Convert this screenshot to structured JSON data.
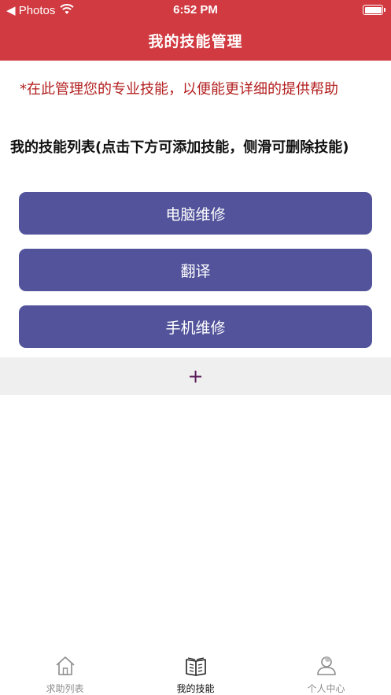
{
  "status_bar": {
    "back_label": "◀ Photos",
    "time": "6:52 PM"
  },
  "nav": {
    "title": "我的技能管理"
  },
  "notice": "*在此管理您的专业技能，以便能更详细的提供帮助",
  "section_title": "我的技能列表(点击下方可添加技能，侧滑可删除技能)",
  "skills": [
    "电脑维修",
    "翻译",
    "手机维修"
  ],
  "add_label": "+",
  "tabs": [
    {
      "label": "求助列表",
      "icon": "home-icon",
      "active": false
    },
    {
      "label": "我的技能",
      "icon": "book-icon",
      "active": true
    },
    {
      "label": "个人中心",
      "icon": "person-icon",
      "active": false
    }
  ],
  "colors": {
    "header": "#d03a40",
    "skill_button": "#52539b",
    "notice_text": "#b31e1e",
    "add_row_bg": "#efefef"
  }
}
